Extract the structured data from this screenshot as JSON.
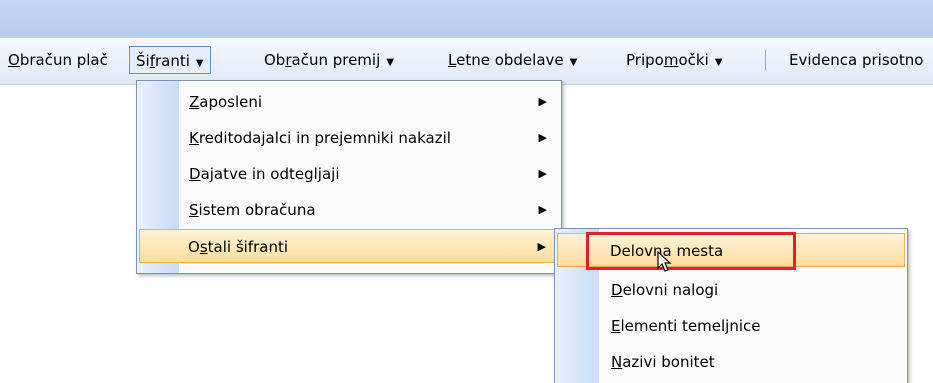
{
  "menubar": {
    "items": [
      {
        "label": "Obračun plač",
        "mnemonic": "O"
      },
      {
        "label": "Šifranti",
        "mnemonic": "f"
      },
      {
        "label": "Obračun premij",
        "mnemonic": "r"
      },
      {
        "label": "Letne obdelave",
        "mnemonic": "L"
      },
      {
        "label": "Pripomočki",
        "mnemonic": "m"
      },
      {
        "label": "Evidenca prisotno",
        "mnemonic": ""
      }
    ]
  },
  "sifranti_menu": {
    "items": [
      {
        "label": "Zaposleni",
        "has_submenu": true
      },
      {
        "label": "Kreditodajalci in prejemniki nakazil",
        "has_submenu": true
      },
      {
        "label": "Dajatve in odtegljaji",
        "has_submenu": true
      },
      {
        "label": "Sistem obračuna",
        "has_submenu": true
      },
      {
        "label": "Ostali šifranti",
        "has_submenu": true,
        "highlighted": true
      }
    ]
  },
  "ostali_submenu": {
    "items": [
      {
        "label": "Delovna mesta",
        "highlighted": true
      },
      {
        "label": "Delovni nalogi"
      },
      {
        "label": "Elementi temeljnice"
      },
      {
        "label": "Nazivi bonitet"
      }
    ]
  },
  "colors": {
    "highlight_border": "#e3202a",
    "menu_highlight": "#ffdca0",
    "active_border": "#6a8fc6"
  },
  "icons": [
    "chevron-down-icon",
    "chevron-right-icon",
    "mouse-cursor-icon"
  ]
}
